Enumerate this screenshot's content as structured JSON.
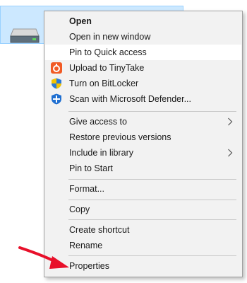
{
  "menu": {
    "items": [
      {
        "label": "Open"
      },
      {
        "label": "Open in new window"
      },
      {
        "label": "Pin to Quick access"
      },
      {
        "label": "Upload to TinyTake",
        "icon": "tinytake-icon"
      },
      {
        "label": "Turn on BitLocker",
        "icon": "bitlocker-shield-icon"
      },
      {
        "label": "Scan with Microsoft Defender...",
        "icon": "defender-icon"
      },
      {
        "label": "Give access to",
        "submenu": true
      },
      {
        "label": "Restore previous versions"
      },
      {
        "label": "Include in library",
        "submenu": true
      },
      {
        "label": "Pin to Start"
      },
      {
        "label": "Format..."
      },
      {
        "label": "Copy"
      },
      {
        "label": "Create shortcut"
      },
      {
        "label": "Rename"
      },
      {
        "label": "Properties"
      }
    ]
  },
  "colors": {
    "selection_bg": "#cce8ff",
    "menu_bg": "#f2f2f2",
    "arrow": "#e8102a"
  }
}
